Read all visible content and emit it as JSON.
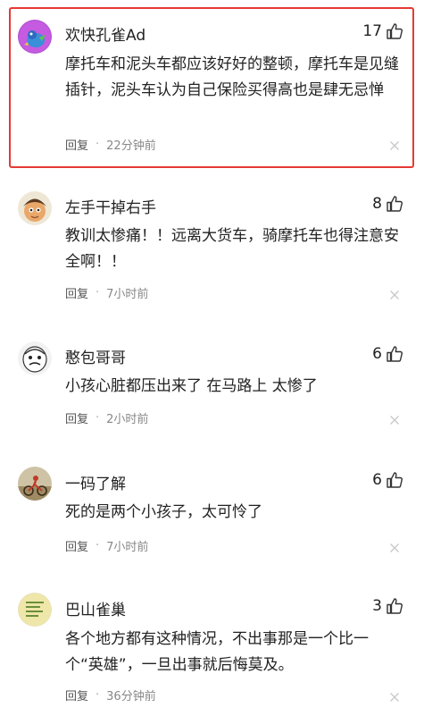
{
  "comments": [
    {
      "user": "欢快孔雀Ad",
      "likes": "17",
      "text": "摩托车和泥头车都应该好好的整顿，摩托车是见缝插针，泥头车认为自己保险买得高也是肆无忌惮",
      "reply": "回复",
      "time": "22分钟前",
      "highlighted": true
    },
    {
      "user": "左手干掉右手",
      "likes": "8",
      "text": "教训太惨痛！！远离大货车，骑摩托车也得注意安全啊！！",
      "reply": "回复",
      "time": "7小时前"
    },
    {
      "user": "憨包哥哥",
      "likes": "6",
      "text": "小孩心脏都压出来了 在马路上 太惨了",
      "reply": "回复",
      "time": "2小时前"
    },
    {
      "user": "一码了解",
      "likes": "6",
      "text": "死的是两个小孩子，太可怜了",
      "reply": "回复",
      "time": "7小时前"
    },
    {
      "user": "巴山雀巢",
      "likes": "3",
      "text": "各个地方都有这种情况，不出事那是一个比一个“英雄”，一旦出事就后悔莫及。",
      "reply": "回复",
      "time": "36分钟前"
    }
  ],
  "dot": "·",
  "icons": {
    "like": "thumbs-up-icon",
    "close": "close-icon"
  },
  "colors": {
    "highlight_border": "#e53935",
    "meta": "#888888",
    "text": "#222222"
  }
}
